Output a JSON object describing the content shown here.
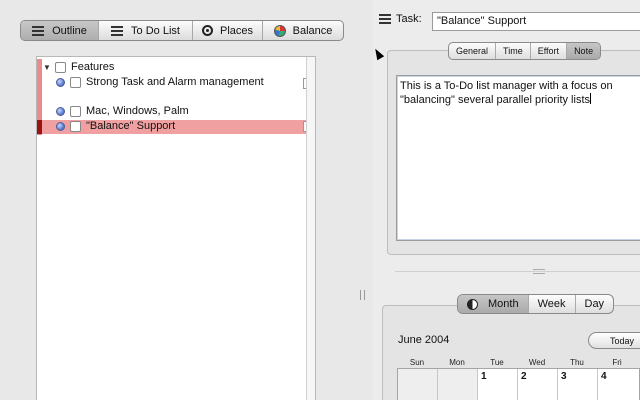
{
  "view_tabs": [
    {
      "label": "Outline",
      "icon": "outline-list-icon",
      "active": true
    },
    {
      "label": "To Do List",
      "icon": "todo-list-icon",
      "active": false
    },
    {
      "label": "Places",
      "icon": "places-target-icon",
      "active": false
    },
    {
      "label": "Balance",
      "icon": "balance-pie-icon",
      "active": false
    }
  ],
  "outline": {
    "rows": [
      {
        "text": "Features",
        "expanded": true
      },
      {
        "text": "Strong Task and Alarm management"
      },
      {
        "text": "Mac, Windows, Palm"
      },
      {
        "text": "\"Balance\" Support",
        "selected": true
      }
    ]
  },
  "task": {
    "label": "Task:",
    "title": "\"Balance\" Support"
  },
  "inspector_tabs": [
    {
      "label": "General",
      "active": false
    },
    {
      "label": "Time",
      "active": false
    },
    {
      "label": "Effort",
      "active": false
    },
    {
      "label": "Note",
      "active": true
    }
  ],
  "note": {
    "text": "This is a To-Do list manager with a focus on \"balancing\" several parallel priority lists"
  },
  "calendar": {
    "views": [
      {
        "label": "Month",
        "active": true
      },
      {
        "label": "Week",
        "active": false
      },
      {
        "label": "Day",
        "active": false
      }
    ],
    "month_title": "June 2004",
    "today_label": "Today",
    "weekdays": [
      "Sun",
      "Mon",
      "Tue",
      "Wed",
      "Thu",
      "Fri"
    ],
    "first_week": [
      "",
      "",
      "1",
      "2",
      "3",
      "4"
    ]
  },
  "colors": {
    "selection": "#f0a0a0",
    "selection_marker": "#9b1414",
    "strip": "#e98b8b"
  }
}
